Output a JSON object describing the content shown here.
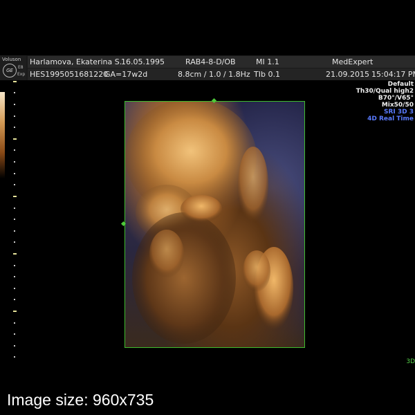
{
  "header": {
    "brand": "Voluson",
    "logo": "GE",
    "mini_labels": [
      "E8",
      "Exp"
    ],
    "patient_name": "Harlamova, Ekaterina S.",
    "dob": "16.05.1995",
    "probe": "RAB4-8-D/OB",
    "mi": "MI  1.1",
    "institution": "MedExpert",
    "patient_id": "HES1995051681220",
    "ga": "GA=17w2d",
    "depth_freq": "8.8cm / 1.0 / 1.8Hz",
    "tib": "TIb  0.1",
    "date": "21.09.2015",
    "time": "15:04:17 PM"
  },
  "params": {
    "preset": "Default",
    "quality": "Th30/Qual high2",
    "angles": "B70°/V65°",
    "mix": "Mix50/50",
    "sri": "SRI 3D 3",
    "mode": "4D Real Time"
  },
  "render_mode_label": "3D",
  "caption": "Image size: 960x735",
  "colors": {
    "roi_border": "#3ebd2e",
    "blue_param": "#5a7bff",
    "sepia_highlight": "#d3954a"
  }
}
